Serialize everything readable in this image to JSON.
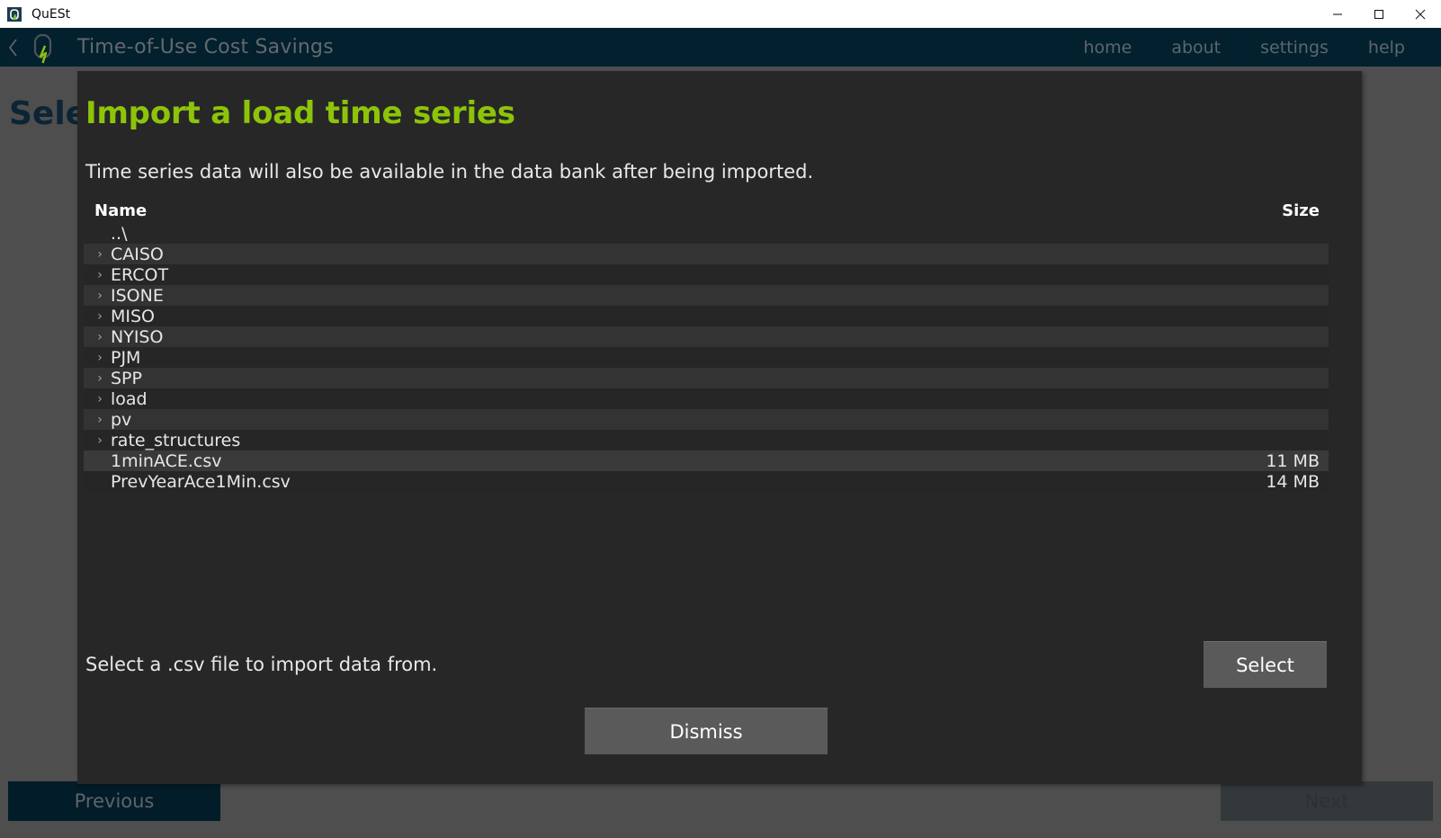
{
  "window": {
    "app_name": "QuESt",
    "icon": "quest-app-icon",
    "controls": {
      "minimize": "minimize-icon",
      "maximize": "maximize-icon",
      "close": "close-icon"
    }
  },
  "header": {
    "back": "back-chevron-icon",
    "logo": "quest-battery-logo",
    "title": "Time-of-Use Cost Savings",
    "nav": [
      {
        "label": "home"
      },
      {
        "label": "about"
      },
      {
        "label": "settings"
      },
      {
        "label": "help"
      }
    ]
  },
  "page": {
    "heading": "Select"
  },
  "bottom_bar": {
    "previous_label": "Previous",
    "next_label": "Next"
  },
  "modal": {
    "title": "Import a load time series",
    "subtitle": "Time series data will also be available in the data bank after being imported.",
    "hint": "Select a .csv file to import data from.",
    "select_label": "Select",
    "dismiss_label": "Dismiss",
    "list": {
      "columns": {
        "name": "Name",
        "size": "Size"
      },
      "rows": [
        {
          "arrow": "",
          "name": "..\\",
          "size": "",
          "kind": "parent",
          "stripe": "plain",
          "selected": false
        },
        {
          "arrow": "›",
          "name": "CAISO",
          "size": "",
          "kind": "folder",
          "stripe": "odd",
          "selected": false
        },
        {
          "arrow": "›",
          "name": "ERCOT",
          "size": "",
          "kind": "folder",
          "stripe": "even",
          "selected": false
        },
        {
          "arrow": "›",
          "name": "ISONE",
          "size": "",
          "kind": "folder",
          "stripe": "odd",
          "selected": false
        },
        {
          "arrow": "›",
          "name": "MISO",
          "size": "",
          "kind": "folder",
          "stripe": "even",
          "selected": false
        },
        {
          "arrow": "›",
          "name": "NYISO",
          "size": "",
          "kind": "folder",
          "stripe": "odd",
          "selected": false
        },
        {
          "arrow": "›",
          "name": "PJM",
          "size": "",
          "kind": "folder",
          "stripe": "even",
          "selected": false
        },
        {
          "arrow": "›",
          "name": "SPP",
          "size": "",
          "kind": "folder",
          "stripe": "odd",
          "selected": false
        },
        {
          "arrow": "›",
          "name": "load",
          "size": "",
          "kind": "folder",
          "stripe": "even",
          "selected": false
        },
        {
          "arrow": "›",
          "name": "pv",
          "size": "",
          "kind": "folder",
          "stripe": "odd",
          "selected": false
        },
        {
          "arrow": "›",
          "name": "rate_structures",
          "size": "",
          "kind": "folder",
          "stripe": "even",
          "selected": false
        },
        {
          "arrow": "",
          "name": "1minACE.csv",
          "size": "11 MB",
          "kind": "file",
          "stripe": "sel",
          "selected": true
        },
        {
          "arrow": "",
          "name": "PrevYearAce1Min.csv",
          "size": "14 MB",
          "kind": "file",
          "stripe": "even",
          "selected": false
        }
      ]
    }
  },
  "colors": {
    "accent_green": "#8dc409",
    "header_navy": "#03202e",
    "modal_bg": "#272727",
    "page_bg": "#4e4e4e",
    "button_gray": "#5a5a5a"
  }
}
